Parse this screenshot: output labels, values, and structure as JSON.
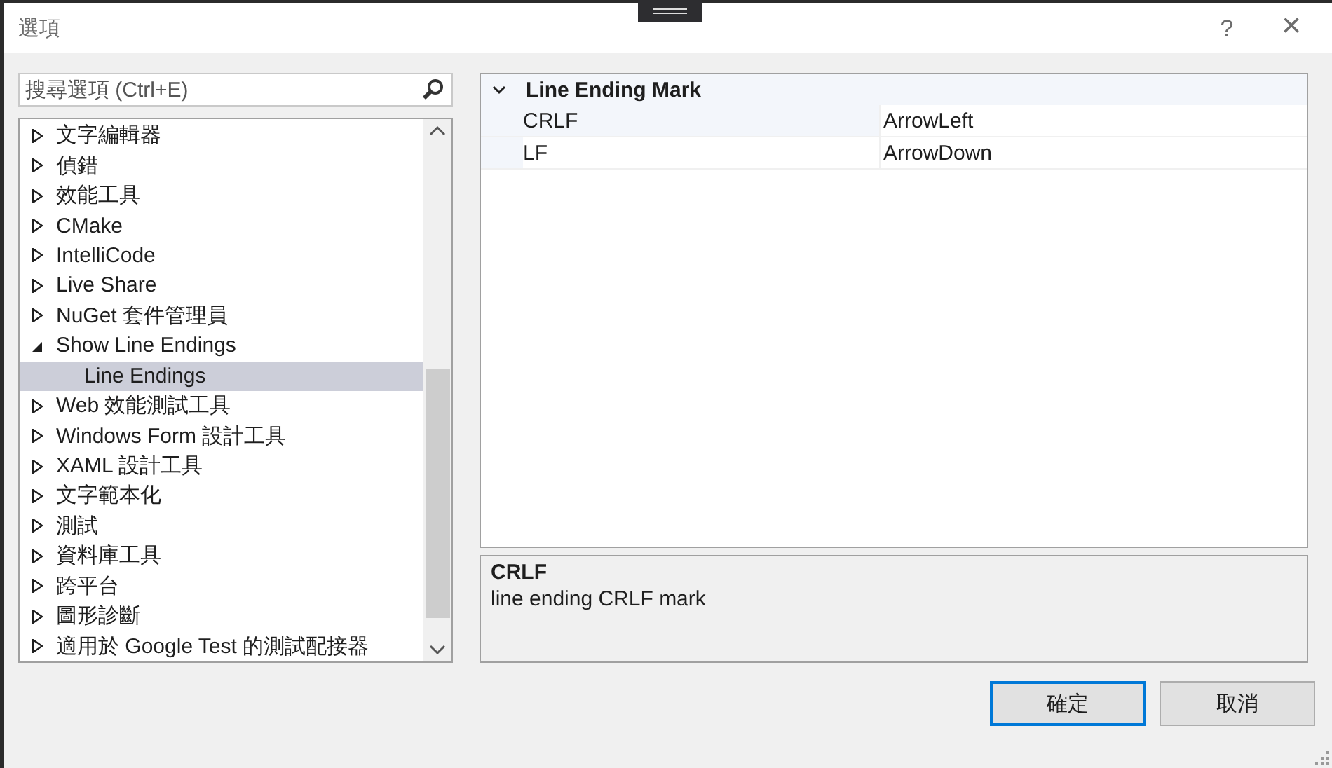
{
  "window": {
    "title": "選項",
    "buttons": [
      "?",
      "×"
    ]
  },
  "search": {
    "placeholder": "搜尋選項 (Ctrl+E)"
  },
  "tree": {
    "items": [
      {
        "label": "文字編輯器",
        "expanded": false,
        "selected": false
      },
      {
        "label": "偵錯",
        "expanded": false,
        "selected": false
      },
      {
        "label": "效能工具",
        "expanded": false,
        "selected": false
      },
      {
        "label": "CMake",
        "expanded": false,
        "selected": false
      },
      {
        "label": "IntelliCode",
        "expanded": false,
        "selected": false
      },
      {
        "label": "Live Share",
        "expanded": false,
        "selected": false
      },
      {
        "label": "NuGet 套件管理員",
        "expanded": false,
        "selected": false
      },
      {
        "label": "Show Line Endings",
        "expanded": true,
        "selected": false,
        "children": [
          {
            "label": "Line Endings",
            "selected": true
          }
        ]
      },
      {
        "label": "Web 效能測試工具",
        "expanded": false,
        "selected": false
      },
      {
        "label": "Windows Form 設計工具",
        "expanded": false,
        "selected": false
      },
      {
        "label": "XAML 設計工具",
        "expanded": false,
        "selected": false
      },
      {
        "label": "文字範本化",
        "expanded": false,
        "selected": false
      },
      {
        "label": "測試",
        "expanded": false,
        "selected": false
      },
      {
        "label": "資料庫工具",
        "expanded": false,
        "selected": false
      },
      {
        "label": "跨平台",
        "expanded": false,
        "selected": false
      },
      {
        "label": "圖形診斷",
        "expanded": false,
        "selected": false
      },
      {
        "label": "適用於 Google Test 的測試配接器",
        "expanded": false,
        "selected": false
      }
    ]
  },
  "property_grid": {
    "category": {
      "label": "Line Ending Mark",
      "expanded": true
    },
    "properties": [
      {
        "name": "CRLF",
        "value": "ArrowLeft",
        "selected": true
      },
      {
        "name": "LF",
        "value": "ArrowDown",
        "selected": false
      }
    ]
  },
  "description": {
    "title": "CRLF",
    "text": "line ending CRLF mark"
  },
  "buttons": [
    {
      "label": "確定",
      "default": true
    },
    {
      "label": "取消",
      "default": false
    }
  ]
}
